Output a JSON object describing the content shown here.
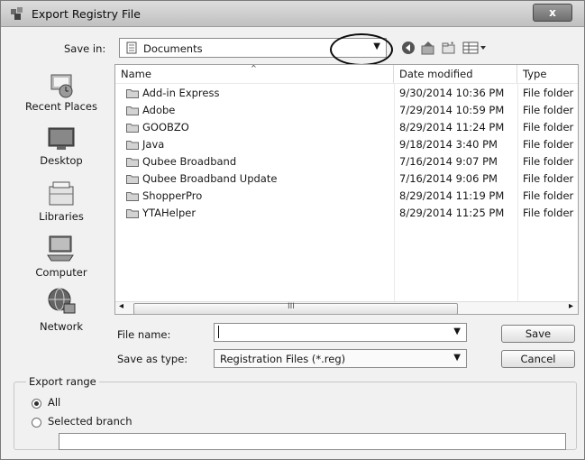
{
  "window": {
    "title": "Export Registry File",
    "close_label": "x"
  },
  "save_in": {
    "label": "Save in:",
    "value": "Documents"
  },
  "places": [
    {
      "label": "Recent Places",
      "icon": "recent-places-icon"
    },
    {
      "label": "Desktop",
      "icon": "desktop-icon"
    },
    {
      "label": "Libraries",
      "icon": "libraries-icon"
    },
    {
      "label": "Computer",
      "icon": "computer-icon"
    },
    {
      "label": "Network",
      "icon": "network-icon"
    }
  ],
  "file_list": {
    "columns": [
      "Name",
      "Date modified",
      "Type"
    ],
    "rows": [
      {
        "name": "Add-in Express",
        "date": "9/30/2014 10:36 PM",
        "type": "File folder"
      },
      {
        "name": "Adobe",
        "date": "7/29/2014 10:59 PM",
        "type": "File folder"
      },
      {
        "name": "GOOBZO",
        "date": "8/29/2014 11:24 PM",
        "type": "File folder"
      },
      {
        "name": "Java",
        "date": "9/18/2014 3:40 PM",
        "type": "File folder"
      },
      {
        "name": "Qubee Broadband",
        "date": "7/16/2014 9:07 PM",
        "type": "File folder"
      },
      {
        "name": "Qubee Broadband Update",
        "date": "7/16/2014 9:06 PM",
        "type": "File folder"
      },
      {
        "name": "ShopperPro",
        "date": "8/29/2014 11:19 PM",
        "type": "File folder"
      },
      {
        "name": "YTAHelper",
        "date": "8/29/2014 11:25 PM",
        "type": "File folder"
      }
    ],
    "scroll_grip": "III"
  },
  "file_name": {
    "label": "File name:",
    "value": ""
  },
  "save_as_type": {
    "label": "Save as type:",
    "value": "Registration Files (*.reg)"
  },
  "buttons": {
    "save": "Save",
    "cancel": "Cancel"
  },
  "export_range": {
    "label": "Export range",
    "options": [
      {
        "label": "All",
        "selected": true
      },
      {
        "label": "Selected branch",
        "selected": false
      }
    ],
    "branch_value": ""
  }
}
